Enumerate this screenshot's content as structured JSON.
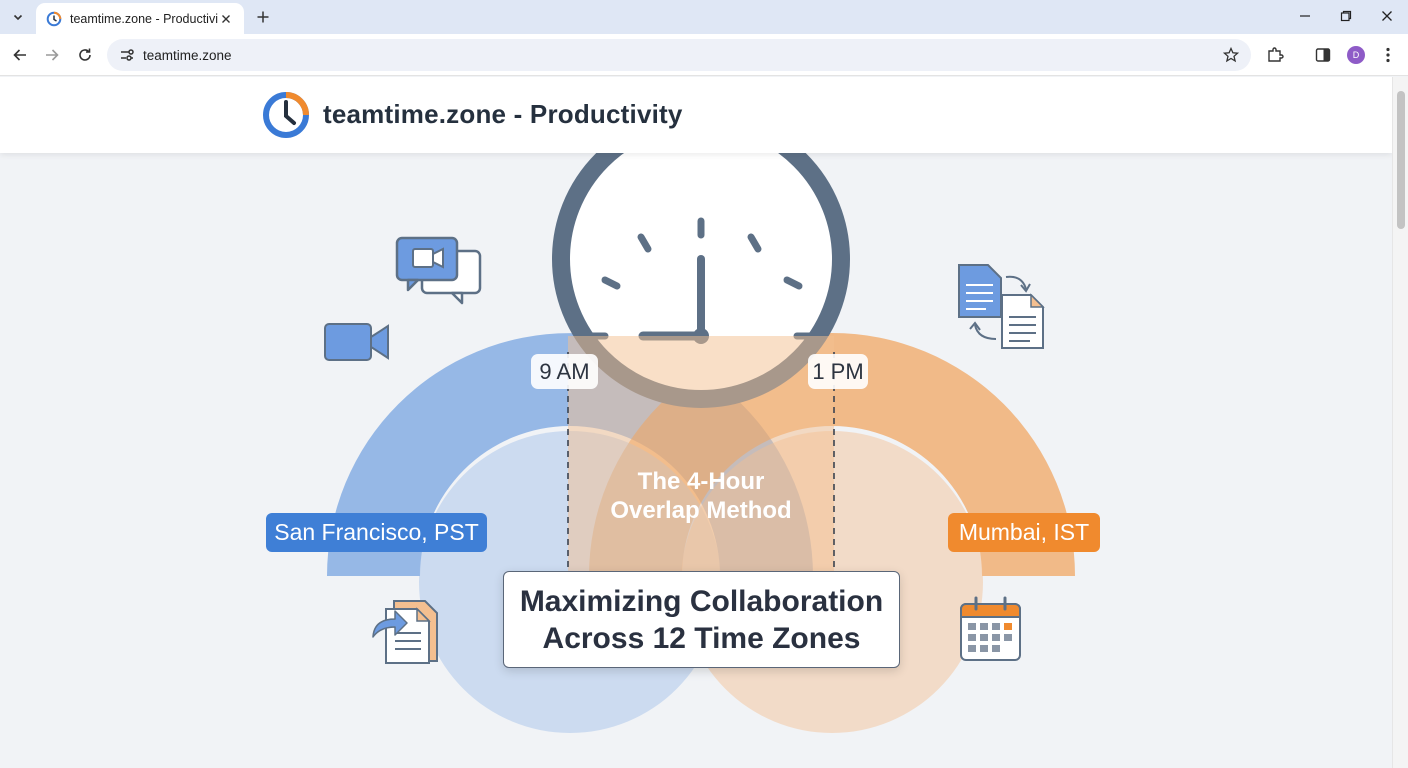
{
  "browser": {
    "tab_title": "teamtime.zone - Productivity",
    "url": "teamtime.zone",
    "profile_initial": "D"
  },
  "header": {
    "title": "teamtime.zone - Productivity"
  },
  "illustration": {
    "left_time": "9 AM",
    "right_time": "1 PM",
    "left_city": "San Francisco, PST",
    "right_city": "Mumbai, IST",
    "method_line1": "The 4-Hour",
    "method_line2": "Overlap Method",
    "card_line1": "Maximizing Collaboration",
    "card_line2": "Across 12 Time Zones"
  },
  "colors": {
    "blue_accent": "#4a86d8",
    "orange_accent": "#f08a2e",
    "clock_frame": "#5d7086"
  },
  "icons": [
    "chevron-down-icon",
    "clock-icon",
    "close-icon",
    "plus-icon",
    "minimize-icon",
    "restore-icon",
    "back-icon",
    "forward-icon",
    "reload-icon",
    "site-settings-icon",
    "star-icon",
    "extensions-icon",
    "sidepanel-icon",
    "more-icon",
    "video-chat-icon",
    "video-camera-icon",
    "document-sync-icon",
    "shared-document-icon",
    "calendar-icon"
  ]
}
